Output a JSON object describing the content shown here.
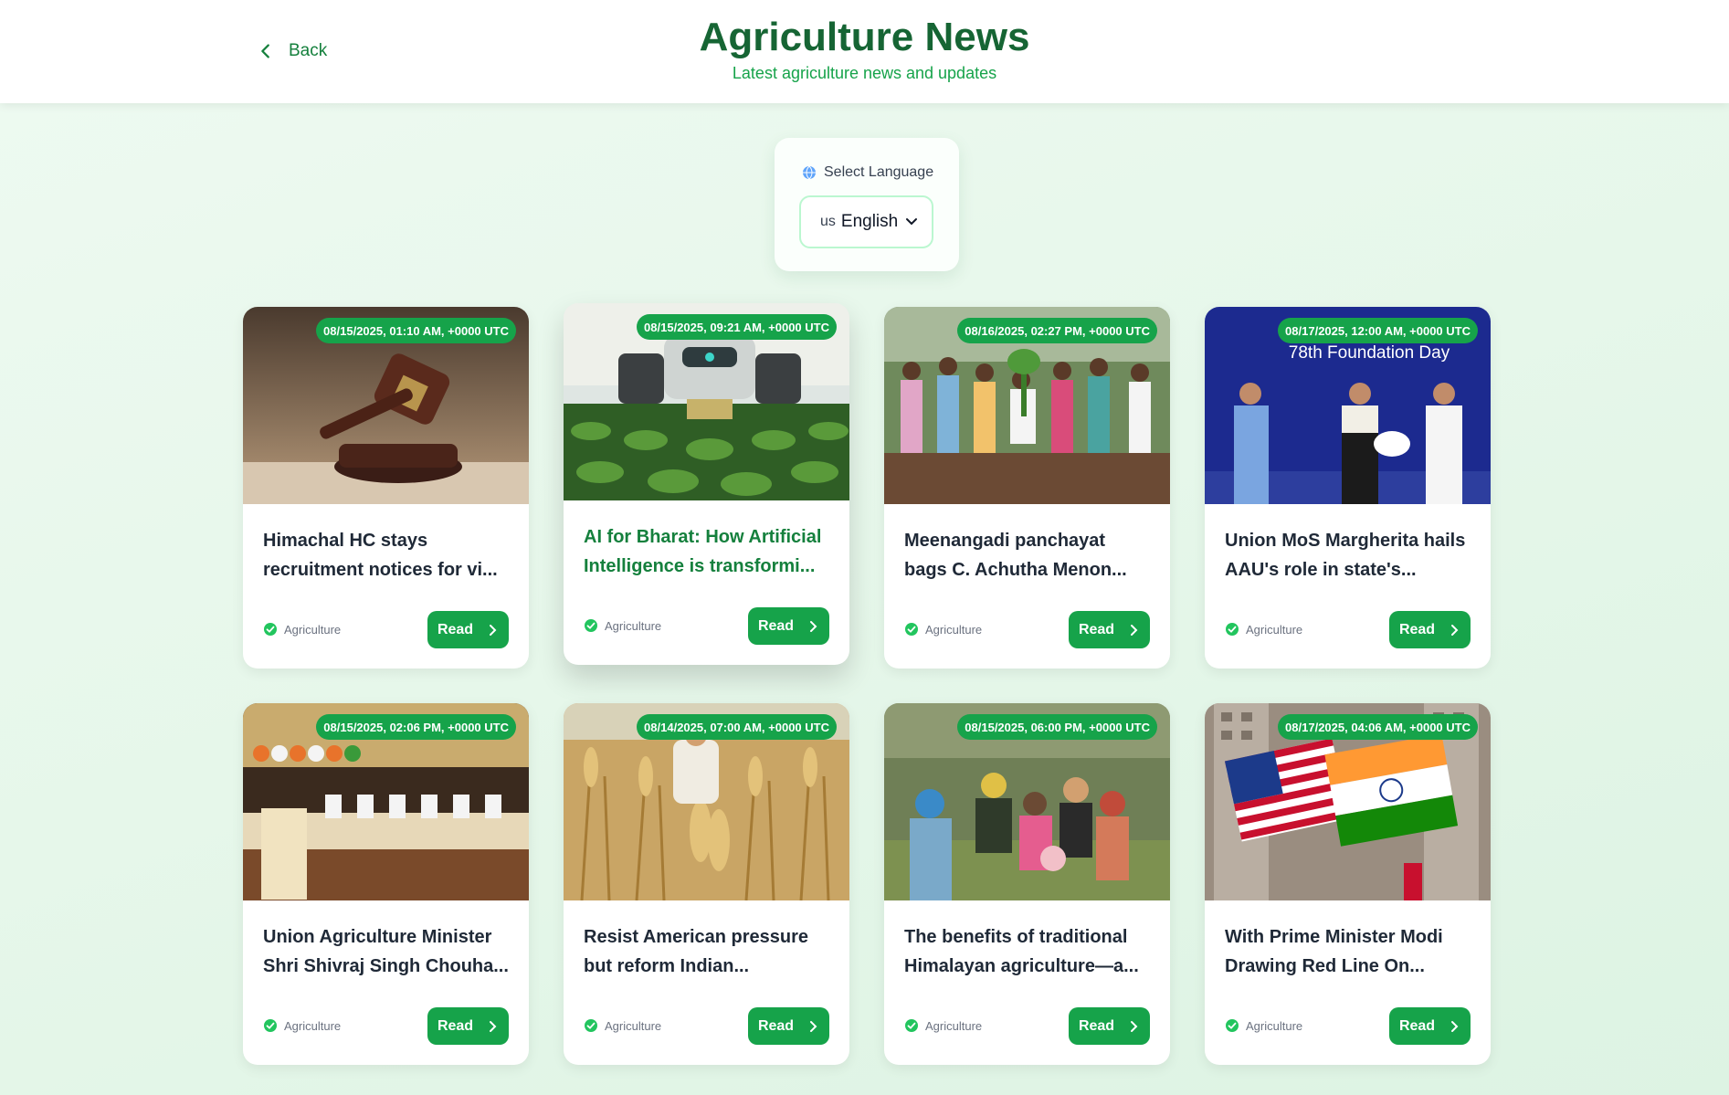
{
  "header": {
    "back_label": "Back",
    "title": "Agriculture News",
    "subtitle": "Latest agriculture news and updates"
  },
  "language": {
    "label": "Select Language",
    "flag": "us",
    "selected": "English"
  },
  "read_label": "Read",
  "articles": [
    {
      "date": "08/15/2025, 01:10 AM, +0000 UTC",
      "title_line1": "Himachal HC stays",
      "title_line2": "recruitment notices for vi...",
      "category": "Agriculture"
    },
    {
      "date": "08/15/2025, 09:21 AM, +0000 UTC",
      "title_line1": "AI for Bharat: How Artificial",
      "title_line2": "Intelligence is transformi...",
      "category": "Agriculture"
    },
    {
      "date": "08/16/2025, 02:27 PM, +0000 UTC",
      "title_line1": "Meenangadi panchayat",
      "title_line2": "bags C. Achutha Menon...",
      "category": "Agriculture"
    },
    {
      "date": "08/17/2025, 12:00 AM, +0000 UTC",
      "title_line1": "Union MoS Margherita hails",
      "title_line2": "AAU's role in state's...",
      "category": "Agriculture",
      "image_text": "78th Foundation Day"
    },
    {
      "date": "08/15/2025, 02:06 PM, +0000 UTC",
      "title_line1": "Union Agriculture Minister",
      "title_line2": "Shri Shivraj Singh Chouha...",
      "category": "Agriculture"
    },
    {
      "date": "08/14/2025, 07:00 AM, +0000 UTC",
      "title_line1": "Resist American pressure",
      "title_line2": "but reform Indian...",
      "category": "Agriculture"
    },
    {
      "date": "08/15/2025, 06:00 PM, +0000 UTC",
      "title_line1": "The benefits of traditional",
      "title_line2": "Himalayan agriculture—a...",
      "category": "Agriculture"
    },
    {
      "date": "08/17/2025, 04:06 AM, +0000 UTC",
      "title_line1": "With Prime Minister Modi",
      "title_line2": "Drawing Red Line On...",
      "category": "Agriculture"
    }
  ],
  "colors": {
    "primary": "#16a34a",
    "title": "#166534",
    "background": "#e8f8ec"
  }
}
